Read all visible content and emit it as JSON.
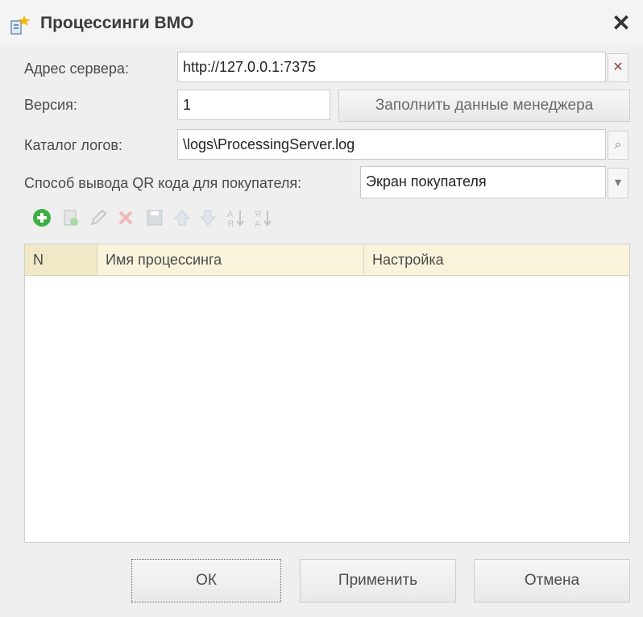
{
  "window": {
    "title": "Процессинги ВМО",
    "close_glyph": "✕"
  },
  "form": {
    "server_label": "Адрес сервера:",
    "server_value": "http://127.0.0.1:7375",
    "version_label": "Версия:",
    "version_value": "1",
    "fill_manager_button": "Заполнить данные менеджера",
    "logs_label": "Каталог логов:",
    "logs_value": "\\logs\\ProcessingServer.log",
    "qr_label": "Способ вывода QR кода для покупателя:",
    "qr_value": "Экран покупателя"
  },
  "toolbar": {
    "icons": [
      "add-icon",
      "copy-icon",
      "edit-icon",
      "delete-icon",
      "save-icon",
      "move-up-icon",
      "move-down-icon",
      "sort-asc-icon",
      "sort-desc-icon"
    ]
  },
  "table": {
    "columns": [
      "N",
      "Имя процессинга",
      "Настройка"
    ],
    "rows": []
  },
  "buttons": {
    "ok": "ОК",
    "apply": "Применить",
    "cancel": "Отмена"
  },
  "colors": {
    "header_bg": "#faf3dc",
    "add_green": "#3cb043"
  }
}
